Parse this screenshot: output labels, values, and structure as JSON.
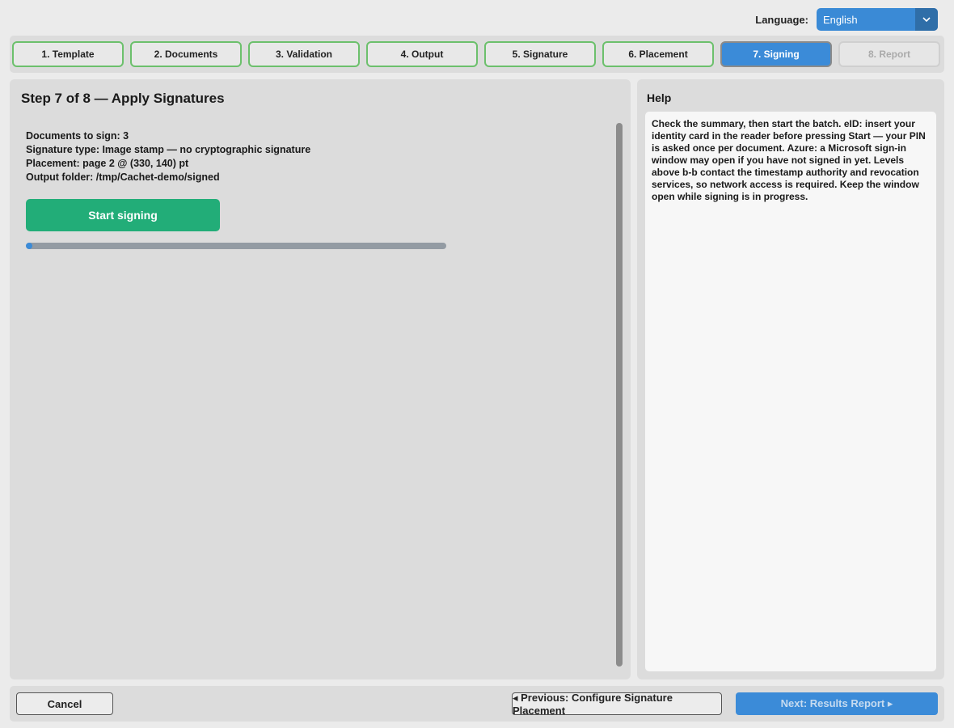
{
  "language": {
    "label": "Language:",
    "selected": "English"
  },
  "steps": [
    {
      "label": "1. Template",
      "state": "done"
    },
    {
      "label": "2. Documents",
      "state": "done"
    },
    {
      "label": "3. Validation",
      "state": "done"
    },
    {
      "label": "4. Output",
      "state": "done"
    },
    {
      "label": "5. Signature",
      "state": "done"
    },
    {
      "label": "6. Placement",
      "state": "done"
    },
    {
      "label": "7. Signing",
      "state": "active"
    },
    {
      "label": "8. Report",
      "state": "disabled"
    }
  ],
  "main": {
    "title": "Step 7 of 8 — Apply Signatures",
    "summary": {
      "documents": "Documents to sign: 3",
      "signature_type": "Signature type: Image stamp — no cryptographic signature",
      "placement": "Placement: page 2 @ (330, 140) pt",
      "output_folder": "Output folder: /tmp/Cachet-demo/signed"
    },
    "start_label": "Start signing",
    "progress": 0.01
  },
  "help": {
    "title": "Help",
    "text_1": "Check the summary, then start the batch. ",
    "bold_1": "eID",
    "text_2": ": insert your identity card in the reader before pressing Start — your PIN is asked once per document. ",
    "bold_2": "Azure",
    "text_3": ": a Microsoft sign-in window may open if you have not signed in yet. Levels above b-b contact the timestamp authority and revocation services, so network access is required. Keep the window open while signing is in progress."
  },
  "footer": {
    "cancel_label": "Cancel",
    "previous_label": "◂  Previous: Configure Signature Placement",
    "next_label": "Next: Results Report  ▸"
  },
  "colors": {
    "accent": "#3b8bd8",
    "success": "#22ad78",
    "step_done_border": "#6cc06c"
  }
}
